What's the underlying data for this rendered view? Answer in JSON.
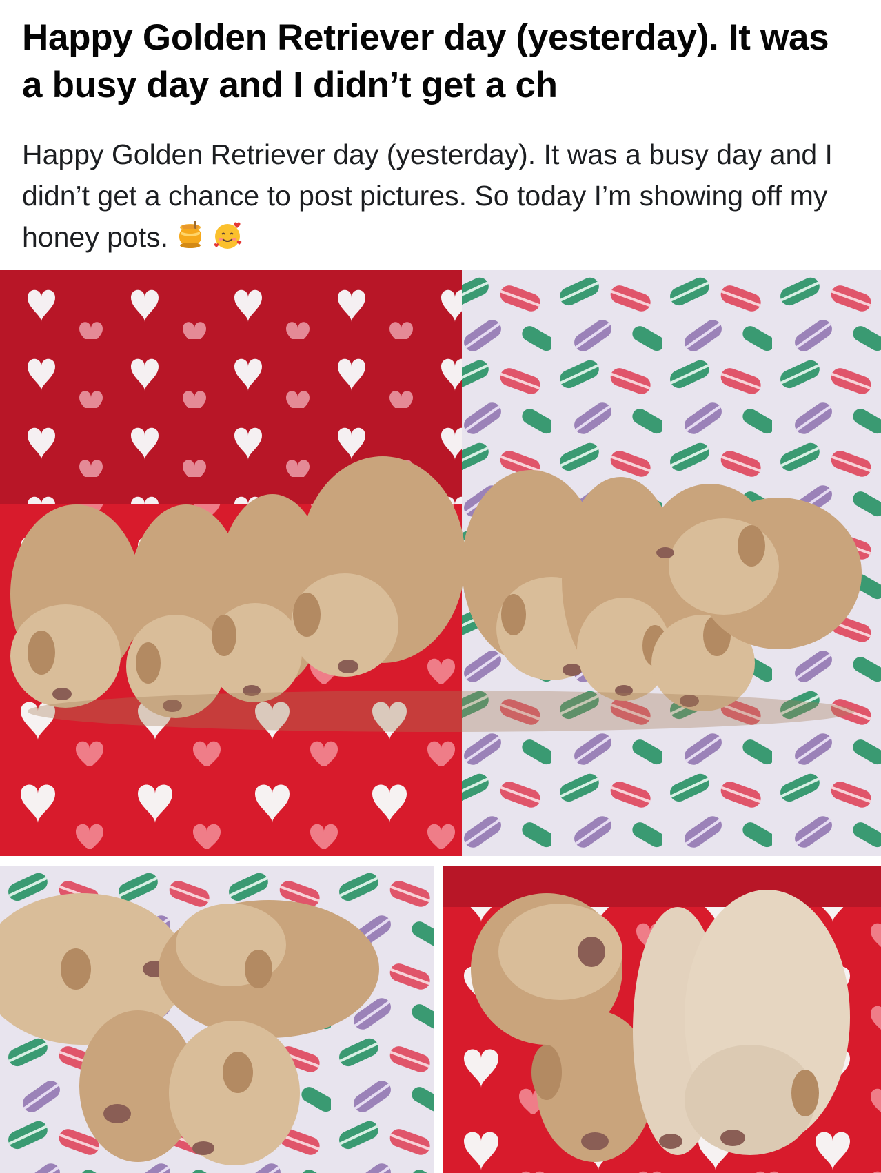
{
  "post": {
    "title": "Happy Golden Retriever day (yesterday). It was a busy day and I didn’t get a ch",
    "body": "Happy Golden Retriever day (yesterday). It was a busy day and I didn’t get a chance to post pictures. So today I’m showing off my honey pots.",
    "emojis": [
      "honey-pot-icon",
      "smiling-face-with-hearts-icon"
    ]
  },
  "photos": [
    {
      "subject": "eight golden retriever puppies sleeping in a row on red heart blanket and macaron blanket"
    },
    {
      "subject": "four golden retriever puppies piled together on macaron blanket"
    },
    {
      "subject": "four golden retriever puppies sleeping on red heart blanket"
    }
  ],
  "colors": {
    "heart_blanket_red": "#d6192b",
    "heart_pillow_red": "#b81627",
    "macaron_blanket": "#e7e4ec",
    "macaron_green": "#3a9a72",
    "macaron_pink": "#e0556a",
    "macaron_purple": "#9b82b8",
    "puppy_fur": "#c9a47c"
  }
}
